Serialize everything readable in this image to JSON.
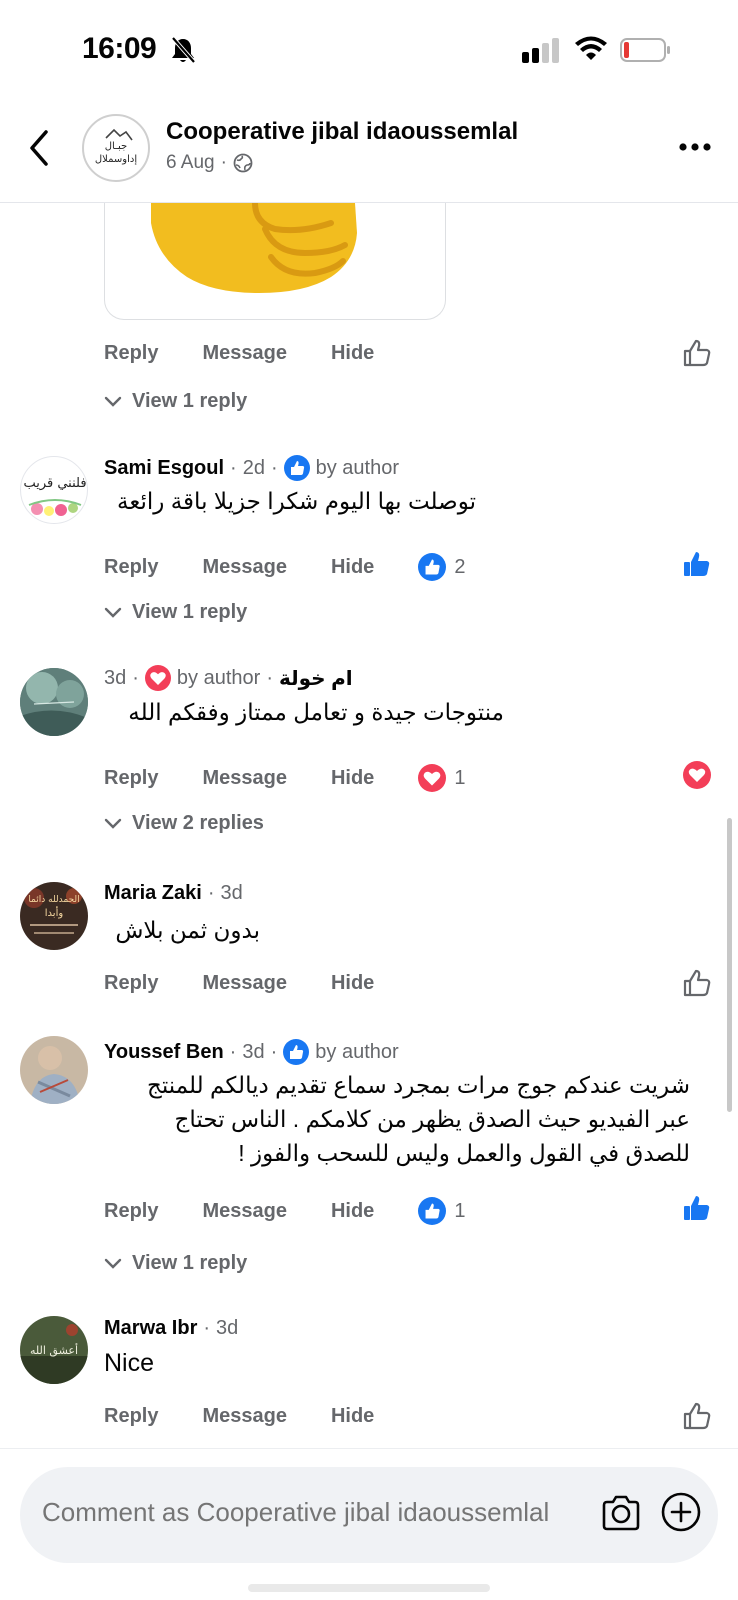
{
  "status_bar": {
    "time": "16:09"
  },
  "header": {
    "page_name": "Cooperative jibal idaoussemlal",
    "date": "6 Aug",
    "separator": "·",
    "avatar_text_line1": "جبـال",
    "avatar_text_line2": "إداوسملال"
  },
  "actions": {
    "reply": "Reply",
    "message": "Message",
    "hide": "Hide"
  },
  "first_comment": {
    "view_replies": "View 1 reply"
  },
  "comments": [
    {
      "author": "Sami Esgoul",
      "time": "2d",
      "author_badge": "by author",
      "badge_type": "like",
      "text": "توصلت بها اليوم شكرا جزيلا باقة رائعة",
      "reaction_count": "2",
      "reaction_type": "like",
      "liked": true,
      "view_replies": "View 1 reply"
    },
    {
      "author": "ام خولة",
      "time": "3d",
      "author_badge": "by author",
      "badge_type": "love",
      "text": "منتوجات جيدة و تعامل ممتاز وفقكم الله",
      "reaction_count": "1",
      "reaction_type": "love",
      "liked": true,
      "view_replies": "View 2 replies"
    },
    {
      "author": "Maria Zaki",
      "time": "3d",
      "text": "بدون ثمن بلاش"
    },
    {
      "author": "Youssef Ben",
      "time": "3d",
      "author_badge": "by author",
      "badge_type": "like",
      "text_lines": [
        "شريت عندكم جوج مرات بمجرد سماع تقديم ديالكم للمنتج",
        "عبر الفيديو حيث الصدق يظهر من كلامكم . الناس تحتاج",
        "للصدق في القول والعمل وليس للسحب والفوز !"
      ],
      "reaction_count": "1",
      "reaction_type": "like",
      "liked": true,
      "view_replies": "View 1 reply"
    },
    {
      "author": "Marwa Ibr",
      "time": "3d",
      "text": "Nice"
    }
  ],
  "avatars": {
    "sami_line1": "فلنني قريب",
    "maria_line1": "الحمدلله دائما",
    "maria_line2": "وأبدا",
    "marwa_line1": "أعشق الله"
  },
  "composer": {
    "placeholder": "Comment as Cooperative jibal idaoussemlal"
  },
  "icons": {
    "back": "chevron-left-icon",
    "more": "more-horizontal-icon",
    "globe": "globe-icon",
    "like": "thumbs-up-icon",
    "love": "heart-icon",
    "camera": "camera-icon",
    "add": "plus-circle-icon",
    "chevron": "chevron-down-icon"
  },
  "colors": {
    "like_blue": "#1877f2",
    "love_red": "#f33e58",
    "secondary_text": "#65676b",
    "sticker_yellow": "#f2bd1f"
  }
}
